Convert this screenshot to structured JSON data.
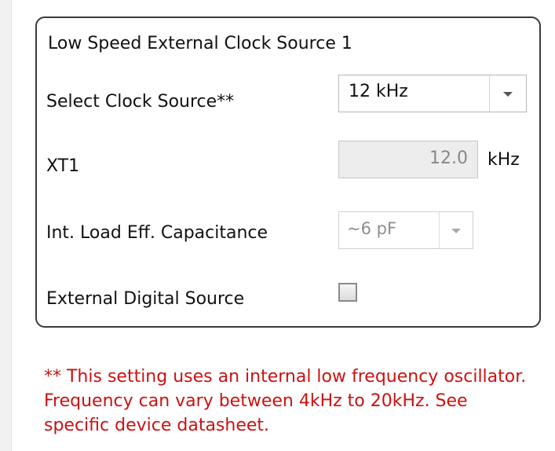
{
  "panel": {
    "title": "Low Speed External Clock Source 1"
  },
  "fields": {
    "select_clock_source": {
      "label": "Select Clock Source**",
      "value": "12 kHz",
      "icon": "chevron-down-icon"
    },
    "xt1": {
      "label": "XT1",
      "value": "12.0",
      "unit": "kHz"
    },
    "capacitance": {
      "label": "Int. Load Eff. Capacitance",
      "value": "~6 pF",
      "icon": "chevron-down-icon"
    },
    "external_digital_source": {
      "label": "External Digital Source",
      "checked": false
    }
  },
  "note": {
    "text": "** This setting uses an internal low frequency oscillator. Frequency can vary between 4kHz to 20kHz. See specific device datasheet."
  },
  "colors": {
    "note_text": "#cc1111",
    "panel_border": "#3a3a3a",
    "readonly_background": "#ededed"
  }
}
